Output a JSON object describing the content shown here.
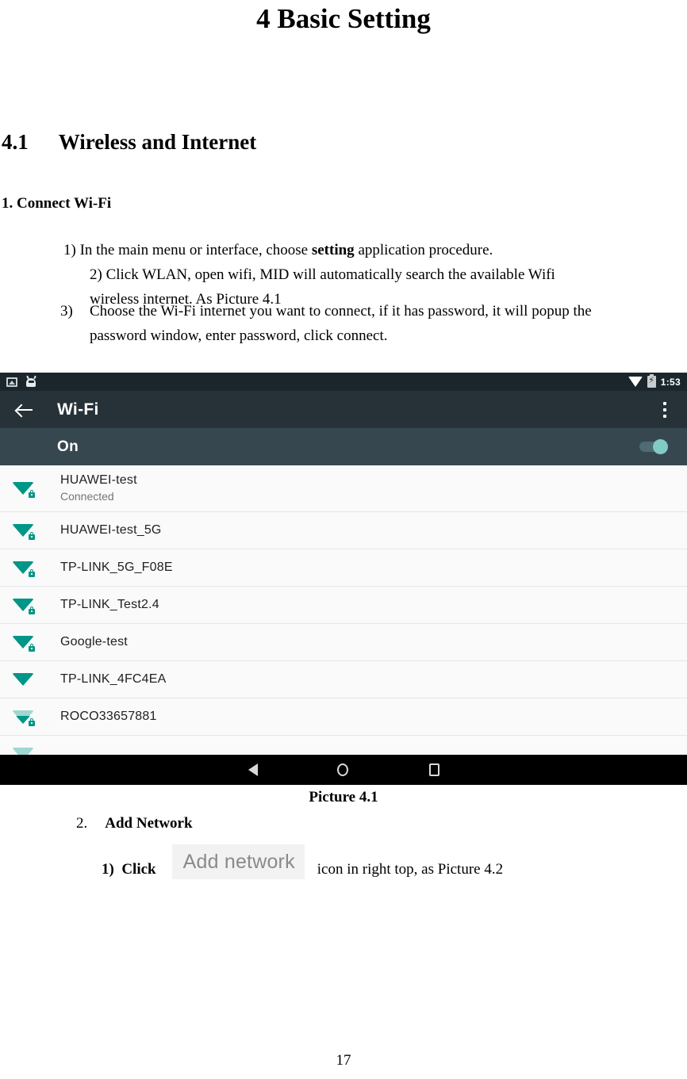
{
  "document": {
    "title": "4 Basic Setting",
    "section": {
      "number": "4.1",
      "heading": "Wireless and Internet"
    },
    "subheading": "1. Connect Wi-Fi",
    "steps": {
      "s1_prefix": "1) In the main menu or interface, choose ",
      "s1_bold": "setting",
      "s1_suffix": " application procedure.",
      "s2_line1": "2)  Click  WLAN,  open  wifi,  MID  will  automatically  search  the  available  Wifi",
      "s2_line2": "wireless internet. As Picture 4.1",
      "s3_num": "3)",
      "s3_line1": "Choose the Wi-Fi internet you want to connect, if it has password, it will popup the",
      "s3_line2": "password window, enter password, click connect."
    },
    "figure_caption": "Picture 4.1",
    "item2": {
      "num": "2.",
      "label": "Add Network"
    },
    "item2_1": {
      "num": "1)",
      "click": "Click",
      "chip_label": "Add network",
      "tail": "icon in right top, as Picture 4.2"
    },
    "page_number": "17"
  },
  "screenshot": {
    "statusbar": {
      "icons_left": [
        "screenshot-icon",
        "android-debug-icon"
      ],
      "wifi_icon": "wifi-icon",
      "battery_icon": "battery-charging-icon",
      "time": "1:53"
    },
    "appbar": {
      "back_icon": "back-arrow-icon",
      "title": "Wi-Fi",
      "overflow_icon": "overflow-menu-icon"
    },
    "toggle_row": {
      "label": "On",
      "state": "on"
    },
    "networks": [
      {
        "ssid": "HUAWEI-test",
        "status": "Connected",
        "secured": true,
        "signal": "strong"
      },
      {
        "ssid": "HUAWEI-test_5G",
        "status": "",
        "secured": true,
        "signal": "strong"
      },
      {
        "ssid": "TP-LINK_5G_F08E",
        "status": "",
        "secured": true,
        "signal": "strong"
      },
      {
        "ssid": "TP-LINK_Test2.4",
        "status": "",
        "secured": true,
        "signal": "strong"
      },
      {
        "ssid": "Google-test",
        "status": "",
        "secured": true,
        "signal": "strong"
      },
      {
        "ssid": "TP-LINK_4FC4EA",
        "status": "",
        "secured": false,
        "signal": "strong"
      },
      {
        "ssid": "ROCO33657881",
        "status": "",
        "secured": true,
        "signal": "weak"
      }
    ],
    "navbar": {
      "back_icon": "nav-back-icon",
      "home_icon": "nav-home-icon",
      "recents_icon": "nav-recents-icon"
    },
    "colors": {
      "statusbar_bg": "#1b262c",
      "appbar_bg": "#263238",
      "toggle_row_bg": "#37474f",
      "accent": "#009688",
      "thumb": "#80cbc4",
      "list_bg": "#fafafa",
      "navbar_bg": "#000000"
    }
  }
}
